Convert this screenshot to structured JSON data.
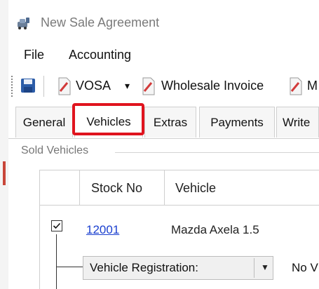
{
  "window": {
    "title": "New Sale Agreement"
  },
  "menu": {
    "items": [
      "File",
      "Accounting"
    ]
  },
  "toolbar": {
    "vosa_label": "VOSA",
    "vosa_dropdown": "▾",
    "wholesale_invoice_label": "Wholesale Invoice",
    "truncated_label": "M"
  },
  "tabs": [
    {
      "label": "General",
      "active": false
    },
    {
      "label": "Vehicles",
      "active": true
    },
    {
      "label": "Extras",
      "active": false
    },
    {
      "label": "Payments",
      "active": false
    },
    {
      "label": "Write",
      "active": false
    }
  ],
  "sold_vehicles": {
    "group_label": "Sold Vehicles",
    "columns": [
      "Stock No",
      "Vehicle"
    ],
    "rows": [
      {
        "checked": true,
        "stock_no": "12001",
        "vehicle": "Mazda Axela 1.5"
      }
    ],
    "detail": {
      "field_label": "Vehicle Registration:",
      "value": "No V"
    }
  },
  "colors": {
    "highlight": "#e0141e",
    "link": "#1a3fcf",
    "save_icon": "#2b5ca8"
  },
  "icons": {
    "title": "car-key-icon",
    "save": "floppy-disk-icon",
    "document": "pdf-document-icon"
  }
}
